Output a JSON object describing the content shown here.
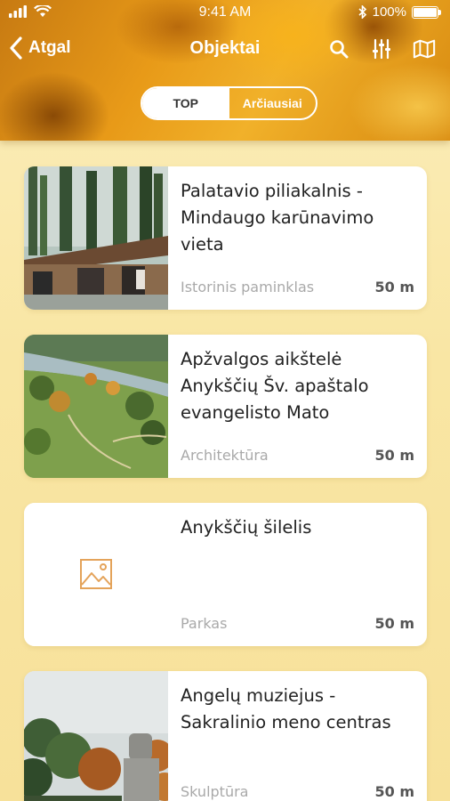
{
  "status_bar": {
    "time": "9:41 AM",
    "battery": "100%"
  },
  "nav": {
    "back_label": "Atgal",
    "title": "Objektai"
  },
  "icons": {
    "back": "chevron-left-icon",
    "search": "search-icon",
    "filter": "sliders-icon",
    "map": "map-icon"
  },
  "segment": {
    "options": [
      "TOP",
      "Arčiausiai"
    ],
    "selected": "TOP"
  },
  "items": [
    {
      "title": "Palatavio piliakalnis - Mindaugo karūnavimo vieta",
      "category": "Istorinis paminklas",
      "distance": "50 m"
    },
    {
      "title": "Apžvalgos aikštelė Anykščių Šv. apaštalo evangelisto Mato",
      "category": "Architektūra",
      "distance": "50 m"
    },
    {
      "title": "Anykščių šilelis",
      "category": "Parkas",
      "distance": "50 m"
    },
    {
      "title": "Angelų muziejus - Sakralinio meno centras",
      "category": "Skulptūra",
      "distance": "50 m"
    }
  ],
  "colors": {
    "accent": "#e8a020",
    "placeholder_icon": "#e4a35a",
    "background": "#f9e6a4"
  }
}
